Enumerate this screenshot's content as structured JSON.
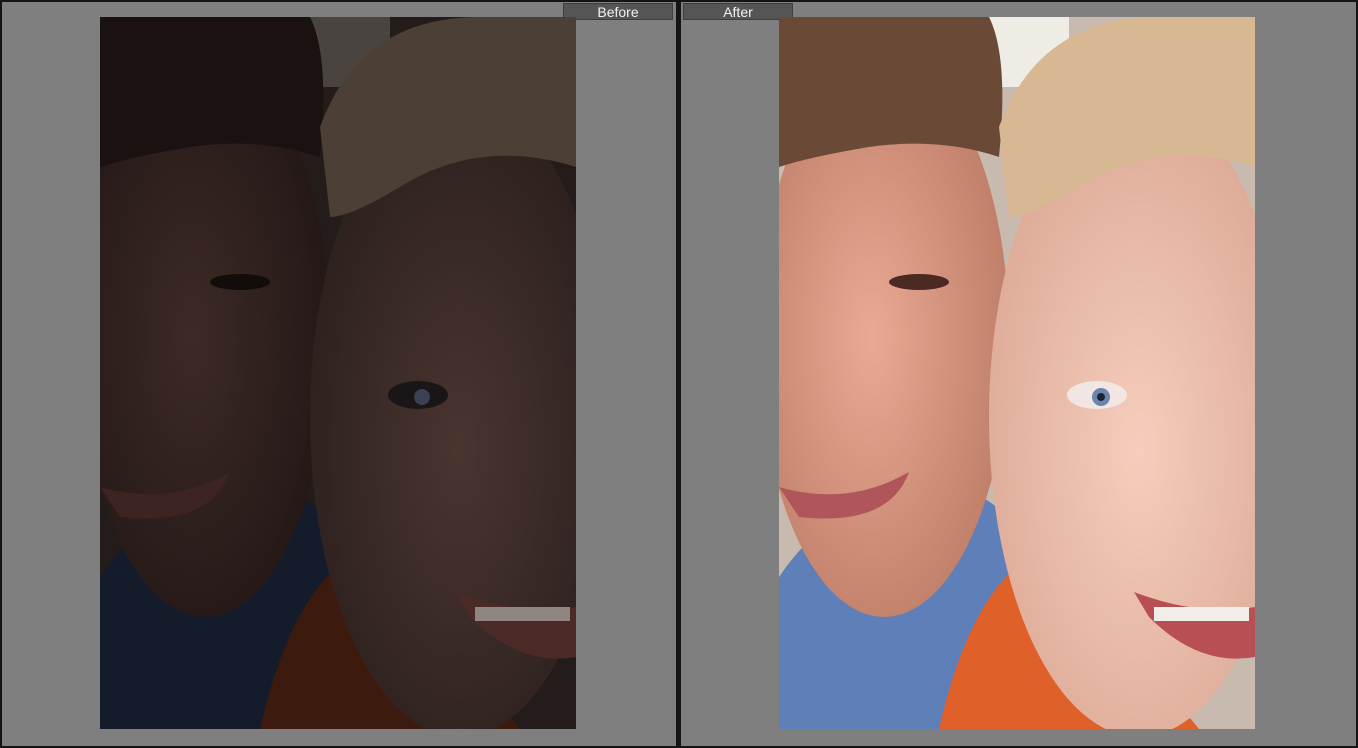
{
  "compare_view": {
    "before_label": "Before",
    "after_label": "After"
  },
  "photos": {
    "before_tone": "dark-underexposed",
    "after_tone": "brightened"
  },
  "colors": {
    "background": "#7f7f7f",
    "label_bg": "#555555",
    "label_text": "#f2f2f2",
    "divider": "#141414"
  }
}
